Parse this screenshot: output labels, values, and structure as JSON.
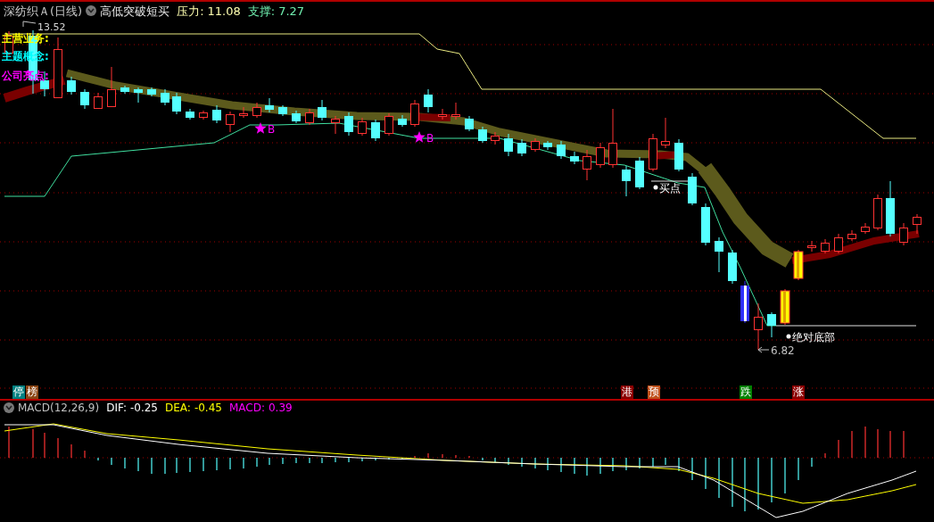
{
  "header": {
    "stock_name": "深纺织Ａ(日线)",
    "indicator": "高低突破短买",
    "pressure_label": "压力:",
    "pressure_value": "11.08",
    "support_label": "支撑:",
    "support_value": "7.27"
  },
  "info_labels": [
    {
      "text": "主营业务:",
      "color": "#ffff00"
    },
    {
      "text": "主题概念:",
      "color": "#00ffff"
    },
    {
      "text": "公司亮点:",
      "color": "#ff00ff"
    }
  ],
  "price_chart": {
    "high_label": "13.52",
    "low_label": "6.82",
    "annotations": [
      {
        "kind": "star",
        "text": "B"
      },
      {
        "kind": "star",
        "text": "B"
      },
      {
        "kind": "dot",
        "text": "买点"
      },
      {
        "kind": "dot",
        "text": "绝对底部"
      }
    ]
  },
  "markers": [
    {
      "text": "停",
      "color": "#008080"
    },
    {
      "text": "榜",
      "color": "#8b4513"
    },
    {
      "text": "港",
      "color": "#8b0000"
    },
    {
      "text": "预",
      "color": "#c0501a"
    },
    {
      "text": "跌",
      "color": "#008000"
    },
    {
      "text": "涨",
      "color": "#8b0000"
    }
  ],
  "macd": {
    "title": "MACD(12,26,9)",
    "dif_label": "DIF:",
    "dif_value": "-0.25",
    "dea_label": "DEA:",
    "dea_value": "-0.45",
    "macd_label": "MACD:",
    "macd_value": "0.39"
  }
}
